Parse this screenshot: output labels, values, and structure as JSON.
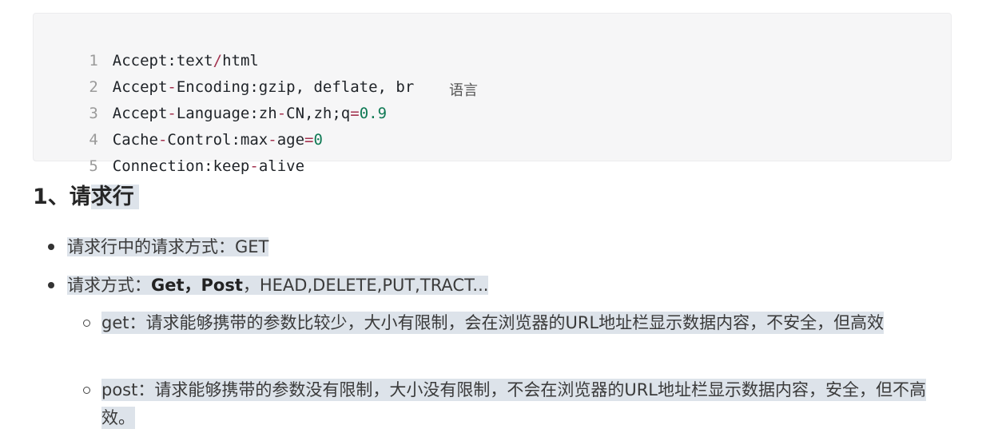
{
  "code": {
    "lines": [
      {
        "num": "1",
        "key": "Accept",
        "sep": ":",
        "value": "text/html"
      },
      {
        "num": "2",
        "key": "Accept-Encoding",
        "sep": ":",
        "value": "gzip, deflate, br"
      },
      {
        "num": "3",
        "key": "Accept-Language",
        "sep": ":",
        "value": "zh-CN,zh;q=0.9"
      },
      {
        "num": "4",
        "key": "Cache-Control",
        "sep": ":",
        "value": "max-age=0"
      },
      {
        "num": "5",
        "key": "Connection",
        "sep": ":",
        "value": "keep-alive"
      }
    ],
    "annotation": "语言"
  },
  "heading": {
    "prefix": "1、请",
    "rest": "求行"
  },
  "list": {
    "item1": "请求行中的请求方式：GET",
    "item2": {
      "prefix": "请求方式：",
      "bold": "Get，Post",
      "suffix": "，HEAD,DELETE,PUT,TRACT..."
    },
    "sub1": "get：请求能够携带的参数比较少，大小有限制，会在浏览器的URL地址栏显示数据内容，不安全，但高效",
    "sub2": "post：请求能够携带的参数没有限制，大小没有限制，不会在浏览器的URL地址栏显示数据内容，安全，但不高效。"
  }
}
